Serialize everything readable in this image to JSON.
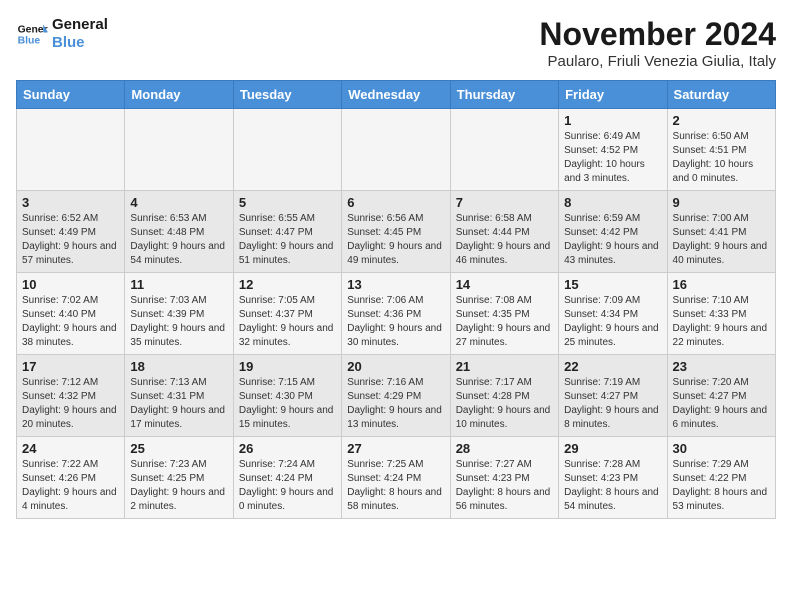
{
  "logo": {
    "line1": "General",
    "line2": "Blue"
  },
  "title": "November 2024",
  "subtitle": "Paularo, Friuli Venezia Giulia, Italy",
  "weekdays": [
    "Sunday",
    "Monday",
    "Tuesday",
    "Wednesday",
    "Thursday",
    "Friday",
    "Saturday"
  ],
  "weeks": [
    [
      {
        "day": "",
        "info": ""
      },
      {
        "day": "",
        "info": ""
      },
      {
        "day": "",
        "info": ""
      },
      {
        "day": "",
        "info": ""
      },
      {
        "day": "",
        "info": ""
      },
      {
        "day": "1",
        "info": "Sunrise: 6:49 AM\nSunset: 4:52 PM\nDaylight: 10 hours and 3 minutes."
      },
      {
        "day": "2",
        "info": "Sunrise: 6:50 AM\nSunset: 4:51 PM\nDaylight: 10 hours and 0 minutes."
      }
    ],
    [
      {
        "day": "3",
        "info": "Sunrise: 6:52 AM\nSunset: 4:49 PM\nDaylight: 9 hours and 57 minutes."
      },
      {
        "day": "4",
        "info": "Sunrise: 6:53 AM\nSunset: 4:48 PM\nDaylight: 9 hours and 54 minutes."
      },
      {
        "day": "5",
        "info": "Sunrise: 6:55 AM\nSunset: 4:47 PM\nDaylight: 9 hours and 51 minutes."
      },
      {
        "day": "6",
        "info": "Sunrise: 6:56 AM\nSunset: 4:45 PM\nDaylight: 9 hours and 49 minutes."
      },
      {
        "day": "7",
        "info": "Sunrise: 6:58 AM\nSunset: 4:44 PM\nDaylight: 9 hours and 46 minutes."
      },
      {
        "day": "8",
        "info": "Sunrise: 6:59 AM\nSunset: 4:42 PM\nDaylight: 9 hours and 43 minutes."
      },
      {
        "day": "9",
        "info": "Sunrise: 7:00 AM\nSunset: 4:41 PM\nDaylight: 9 hours and 40 minutes."
      }
    ],
    [
      {
        "day": "10",
        "info": "Sunrise: 7:02 AM\nSunset: 4:40 PM\nDaylight: 9 hours and 38 minutes."
      },
      {
        "day": "11",
        "info": "Sunrise: 7:03 AM\nSunset: 4:39 PM\nDaylight: 9 hours and 35 minutes."
      },
      {
        "day": "12",
        "info": "Sunrise: 7:05 AM\nSunset: 4:37 PM\nDaylight: 9 hours and 32 minutes."
      },
      {
        "day": "13",
        "info": "Sunrise: 7:06 AM\nSunset: 4:36 PM\nDaylight: 9 hours and 30 minutes."
      },
      {
        "day": "14",
        "info": "Sunrise: 7:08 AM\nSunset: 4:35 PM\nDaylight: 9 hours and 27 minutes."
      },
      {
        "day": "15",
        "info": "Sunrise: 7:09 AM\nSunset: 4:34 PM\nDaylight: 9 hours and 25 minutes."
      },
      {
        "day": "16",
        "info": "Sunrise: 7:10 AM\nSunset: 4:33 PM\nDaylight: 9 hours and 22 minutes."
      }
    ],
    [
      {
        "day": "17",
        "info": "Sunrise: 7:12 AM\nSunset: 4:32 PM\nDaylight: 9 hours and 20 minutes."
      },
      {
        "day": "18",
        "info": "Sunrise: 7:13 AM\nSunset: 4:31 PM\nDaylight: 9 hours and 17 minutes."
      },
      {
        "day": "19",
        "info": "Sunrise: 7:15 AM\nSunset: 4:30 PM\nDaylight: 9 hours and 15 minutes."
      },
      {
        "day": "20",
        "info": "Sunrise: 7:16 AM\nSunset: 4:29 PM\nDaylight: 9 hours and 13 minutes."
      },
      {
        "day": "21",
        "info": "Sunrise: 7:17 AM\nSunset: 4:28 PM\nDaylight: 9 hours and 10 minutes."
      },
      {
        "day": "22",
        "info": "Sunrise: 7:19 AM\nSunset: 4:27 PM\nDaylight: 9 hours and 8 minutes."
      },
      {
        "day": "23",
        "info": "Sunrise: 7:20 AM\nSunset: 4:27 PM\nDaylight: 9 hours and 6 minutes."
      }
    ],
    [
      {
        "day": "24",
        "info": "Sunrise: 7:22 AM\nSunset: 4:26 PM\nDaylight: 9 hours and 4 minutes."
      },
      {
        "day": "25",
        "info": "Sunrise: 7:23 AM\nSunset: 4:25 PM\nDaylight: 9 hours and 2 minutes."
      },
      {
        "day": "26",
        "info": "Sunrise: 7:24 AM\nSunset: 4:24 PM\nDaylight: 9 hours and 0 minutes."
      },
      {
        "day": "27",
        "info": "Sunrise: 7:25 AM\nSunset: 4:24 PM\nDaylight: 8 hours and 58 minutes."
      },
      {
        "day": "28",
        "info": "Sunrise: 7:27 AM\nSunset: 4:23 PM\nDaylight: 8 hours and 56 minutes."
      },
      {
        "day": "29",
        "info": "Sunrise: 7:28 AM\nSunset: 4:23 PM\nDaylight: 8 hours and 54 minutes."
      },
      {
        "day": "30",
        "info": "Sunrise: 7:29 AM\nSunset: 4:22 PM\nDaylight: 8 hours and 53 minutes."
      }
    ]
  ]
}
